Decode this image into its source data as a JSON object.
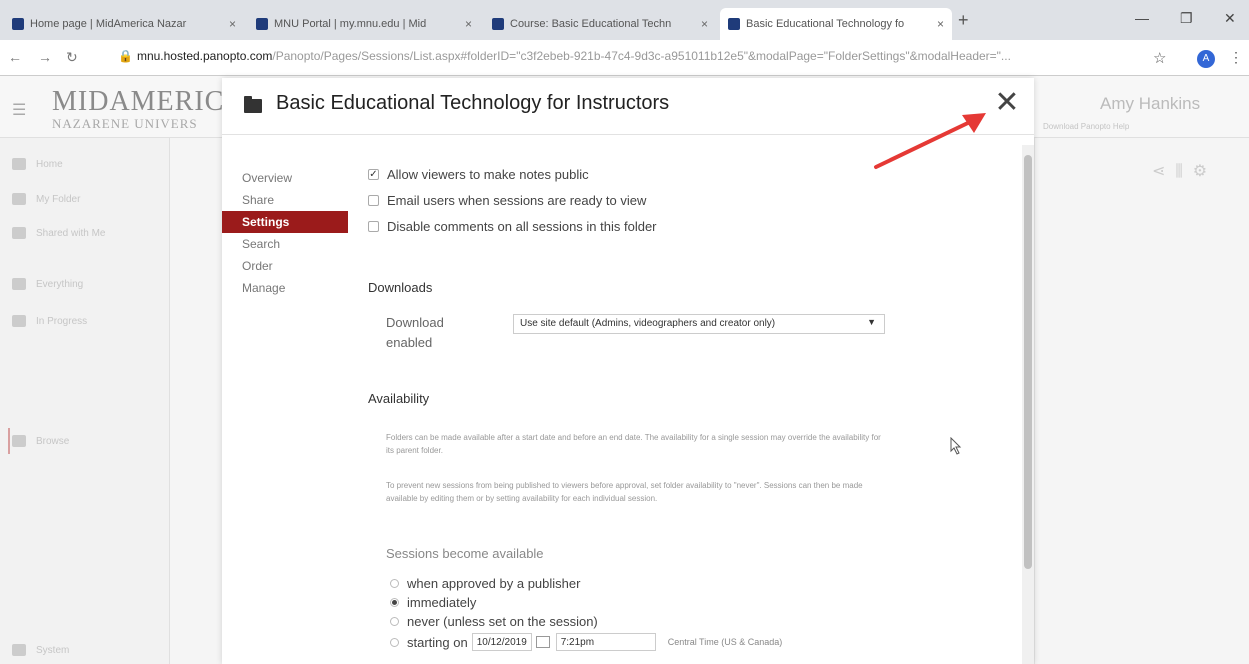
{
  "browser": {
    "tabs": [
      {
        "title": "Home page | MidAmerica Nazar"
      },
      {
        "title": "MNU Portal | my.mnu.edu | Mid"
      },
      {
        "title": "Course: Basic Educational Techn"
      },
      {
        "title": "Basic Educational Technology fo"
      }
    ],
    "url_host": "mnu.hosted.panopto.com",
    "url_path": "/Panopto/Pages/Sessions/List.aspx#folderID=\"c3f2ebeb-921b-47c4-9d3c-a951011b12e5\"&modalPage=\"FolderSettings\"&modalHeader=\"...",
    "profile_initial": "A"
  },
  "app": {
    "logo_line1": "MIDAMERIC",
    "logo_line2": "NAZARENE UNIVERS",
    "user_name": "Amy Hankins",
    "download_label": "Download Panopto   Help",
    "sidebar": [
      {
        "label": "Home",
        "icon": "home-icon"
      },
      {
        "label": "My Folder",
        "icon": "folder-icon"
      },
      {
        "label": "Shared with Me",
        "icon": "share-icon"
      },
      {
        "label": "Everything",
        "icon": "grid-icon"
      },
      {
        "label": "In Progress",
        "icon": "progress-icon"
      },
      {
        "label": "Browse",
        "icon": "browse-icon"
      },
      {
        "label": "System",
        "icon": "gear-icon"
      }
    ]
  },
  "modal": {
    "title": "Basic Educational Technology for Instructors",
    "nav": [
      "Overview",
      "Share",
      "Settings",
      "Search",
      "Order",
      "Manage"
    ],
    "active_nav": "Settings",
    "checkboxes": [
      {
        "label": "Allow viewers to make notes public",
        "checked": true
      },
      {
        "label": "Email users when sessions are ready to view",
        "checked": false
      },
      {
        "label": "Disable comments on all sessions in this folder",
        "checked": false
      }
    ],
    "downloads_title": "Downloads",
    "download_enabled_label": "Download enabled",
    "download_select_value": "Use site default (Admins, videographers and creator only)",
    "availability_title": "Availability",
    "availability_para1": "Folders can be made available after a start date and before an end date. The availability for a single session may override the availability for its parent folder.",
    "availability_para2": "To prevent new sessions from being published to viewers before approval, set folder availability to \"never\". Sessions can then be made available by editing them or by setting availability for each individual session.",
    "sessions_become_available": "Sessions become available",
    "radios": [
      {
        "label": "when approved by a publisher",
        "selected": false
      },
      {
        "label": "immediately",
        "selected": true
      },
      {
        "label": "never (unless set on the session)",
        "selected": false
      },
      {
        "label": "starting on",
        "selected": false
      }
    ],
    "start_date": "10/12/2019",
    "start_time": "7:21pm",
    "timezone": "Central Time (US & Canada)"
  },
  "colors": {
    "accent": "#9b1b1b",
    "annotation_arrow": "#e53935"
  }
}
